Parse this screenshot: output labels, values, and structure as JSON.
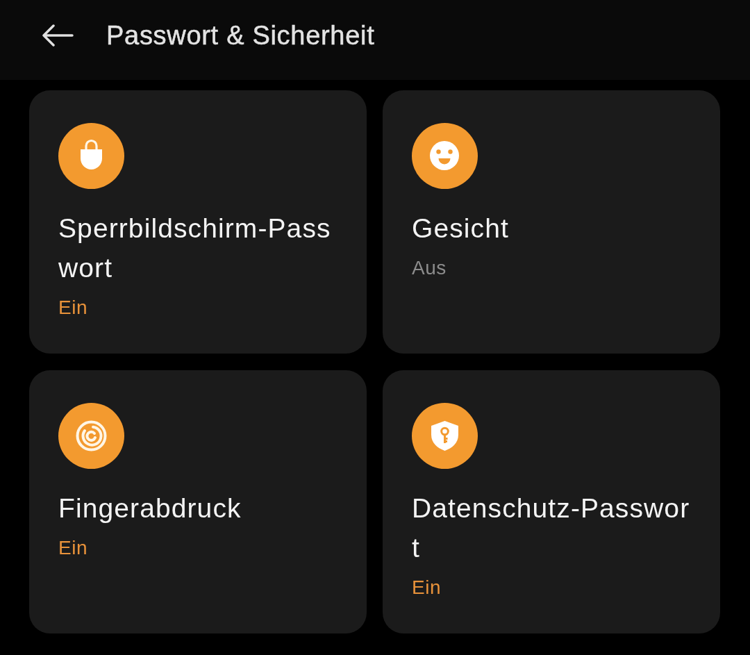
{
  "header": {
    "title": "Passwort & Sicherheit"
  },
  "cards": [
    {
      "kind": "lock",
      "title": "Sperrbildschirm-Passwort",
      "status": "Ein",
      "on": true
    },
    {
      "kind": "face",
      "title": "Gesicht",
      "status": "Aus",
      "on": false
    },
    {
      "kind": "fingerprint",
      "title": "Fingerabdruck",
      "status": "Ein",
      "on": true
    },
    {
      "kind": "shield-key",
      "title": "Datenschutz-Passwort",
      "status": "Ein",
      "on": true
    }
  ]
}
